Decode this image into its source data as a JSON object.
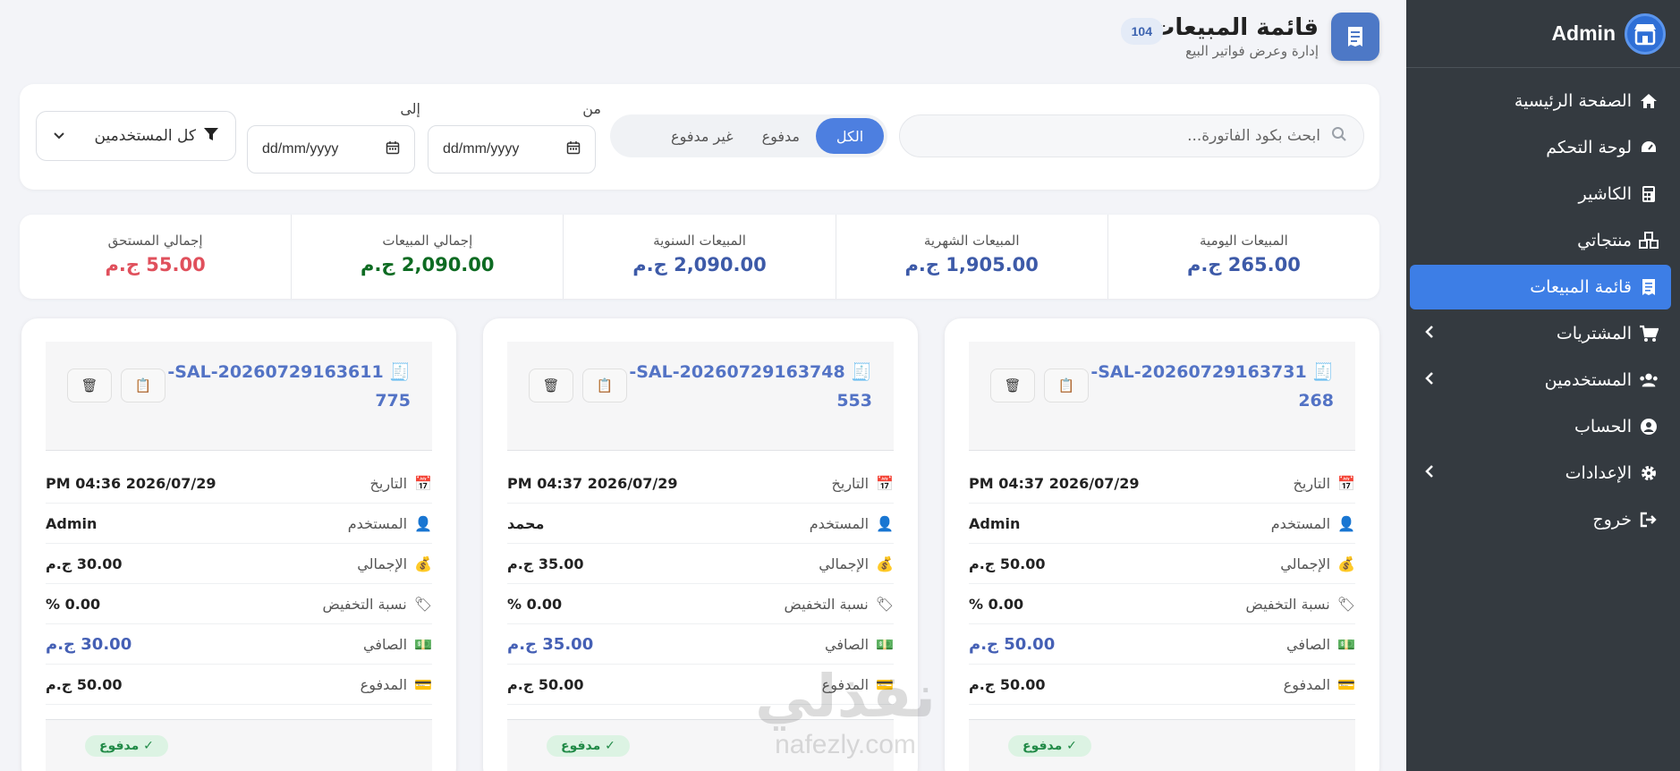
{
  "sidebar": {
    "brand": "Admin",
    "items": [
      {
        "label": "الصفحة الرئيسية",
        "icon": "home-icon"
      },
      {
        "label": "لوحة التحكم",
        "icon": "gauge-icon"
      },
      {
        "label": "الكاشير",
        "icon": "calculator-icon"
      },
      {
        "label": "منتجاتي",
        "icon": "cubes-icon"
      },
      {
        "label": "قائمة المبيعات",
        "icon": "receipt-icon",
        "active": true
      },
      {
        "label": "المشتريات",
        "icon": "cart-icon",
        "expandable": true
      },
      {
        "label": "المستخدمين",
        "icon": "users-icon",
        "expandable": true
      },
      {
        "label": "الحساب",
        "icon": "user-circle-icon"
      },
      {
        "label": "الإعدادات",
        "icon": "gear-icon",
        "expandable": true
      },
      {
        "label": "خروج",
        "icon": "logout-icon"
      }
    ]
  },
  "header": {
    "title": "قائمة المبيعات",
    "subtitle": "إدارة وعرض فواتير البيع",
    "count": "104"
  },
  "filters": {
    "search_placeholder": "ابحث بكود الفاتورة...",
    "status_tabs": [
      "الكل",
      "مدفوع",
      "غير مدفوع"
    ],
    "from_label": "من",
    "to_label": "إلى",
    "from_value": "dd/mm/yyyy",
    "to_value": "dd/mm/yyyy",
    "user_select": "كل المستخدمين"
  },
  "stats": [
    {
      "label": "المبيعات اليومية",
      "value": "265.00 ج.م",
      "color": "#3d5aa8"
    },
    {
      "label": "المبيعات الشهرية",
      "value": "1,905.00 ج.م",
      "color": "#3d5aa8"
    },
    {
      "label": "المبيعات السنوية",
      "value": "2,090.00 ج.م",
      "color": "#3d5aa8"
    },
    {
      "label": "إجمالي المبيعات",
      "value": "2,090.00 ج.م",
      "color": "#0d6b22"
    },
    {
      "label": "إجمالي المستحق",
      "value": "55.00 ج.م",
      "color": "#e0505c"
    }
  ],
  "row_labels": {
    "date": "التاريخ",
    "user": "المستخدم",
    "total": "الإجمالي",
    "discount": "نسبة التخفيض",
    "net": "الصافي",
    "paid": "المدفوع"
  },
  "cards": [
    {
      "code_line1": "SAL-20260729163731-",
      "code_line2": "268",
      "date": "PM 04:37 2026/07/29",
      "user": "Admin",
      "total": "50.00 ج.م",
      "discount": "0.00 %",
      "net": "50.00 ج.م",
      "paid": "50.00 ج.م",
      "status": "✓ مدفوع"
    },
    {
      "code_line1": "SAL-20260729163748-",
      "code_line2": "553",
      "date": "PM 04:37 2026/07/29",
      "user": "محمد",
      "total": "35.00 ج.م",
      "discount": "0.00 %",
      "net": "35.00 ج.م",
      "paid": "50.00 ج.م",
      "status": "✓ مدفوع"
    },
    {
      "code_line1": "SAL-20260729163611-",
      "code_line2": "775",
      "date": "PM 04:36 2026/07/29",
      "user": "Admin",
      "total": "30.00 ج.م",
      "discount": "0.00 %",
      "net": "30.00 ج.م",
      "paid": "50.00 ج.م",
      "status": "✓ مدفوع"
    }
  ],
  "watermark": {
    "arabic": "نفذلي",
    "latin": "nafezly.com"
  }
}
